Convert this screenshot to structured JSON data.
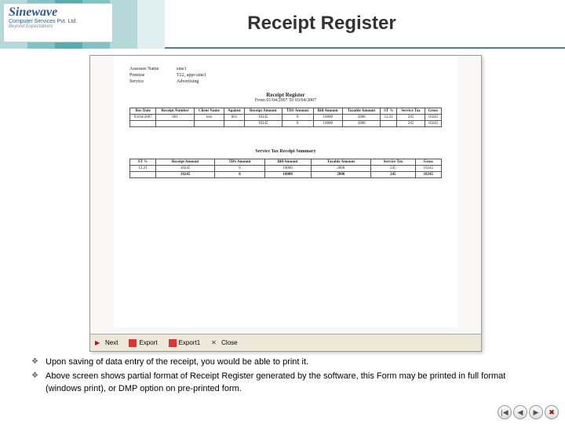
{
  "logo": {
    "name": "Sinewave",
    "sub": "Computer Services Pvt. Ltd.",
    "tag": "Beyond Expectations"
  },
  "title": "Receipt Register",
  "doc": {
    "fields": {
      "assessee_label": "Assessee Name",
      "assessee_value": "sine1",
      "premise_label": "Premise",
      "premise_value": "T22",
      "premise_extra": ", appr-sine1",
      "service_label": "Service",
      "service_value": "Advertising"
    },
    "report_title": "Receipt Register",
    "report_sub": "From 01/04/2007 To 03/04/2007",
    "headers": [
      "Rec Date",
      "Receipt Number",
      "Client Name",
      "Against",
      "Receipt Amount",
      "TDS Amount",
      "Bill Amount",
      "Taxable Amount",
      "ST %",
      "Service Tax",
      "Gross"
    ],
    "rows": [
      [
        "03/04/2007",
        "001",
        "test",
        "001",
        "10245",
        "0",
        "10000",
        "2000",
        "12.21",
        "245",
        "10245"
      ],
      [
        "",
        "",
        "",
        "",
        "10245",
        "0",
        "10000",
        "2000",
        "",
        "245",
        "10245"
      ]
    ],
    "summary_title": "Service Tax Receipt Summary",
    "sum_headers": [
      "ST %",
      "Receipt Amount",
      "TDS Amount",
      "Bill Amount",
      "Taxable Amount",
      "Service Tax",
      "Gross"
    ],
    "sum_rows": [
      [
        "12.21",
        "10245",
        "0",
        "10000",
        "2000",
        "245",
        "10245"
      ],
      [
        "",
        "10245",
        "0",
        "10000",
        "2000",
        "245",
        "10245"
      ]
    ]
  },
  "toolbar": {
    "next": "Next",
    "export": "Export",
    "export1": "Export1",
    "close": "Close"
  },
  "bullets": [
    "Upon saving of data entry of the receipt, you would be able to  print it.",
    "Above screen shows partial format of Receipt Register generated by the software, this Form may be printed in full format (windows print), or DMP option on pre-printed form."
  ],
  "nav": {
    "first": "|◀",
    "prev": "◀",
    "next": "▶",
    "end": "✖"
  }
}
